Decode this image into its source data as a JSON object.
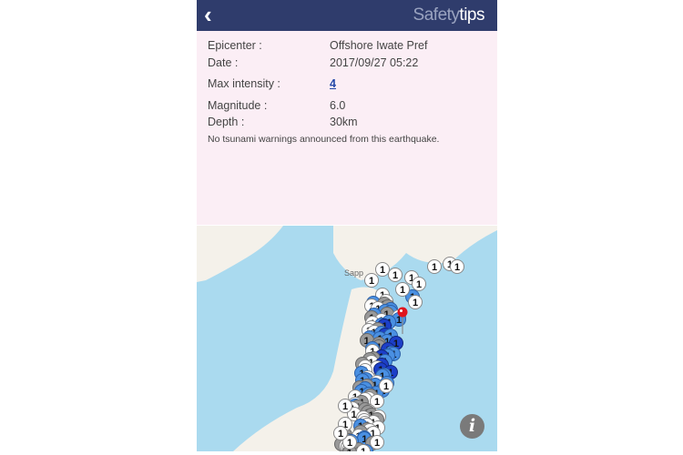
{
  "header": {
    "back_icon": "chevron-left-icon",
    "title_light": "Safety",
    "title_bold": "tips"
  },
  "details": {
    "epicenter_label": "Epicenter :",
    "epicenter": "Offshore Iwate Pref",
    "date_label": "Date :",
    "date": "2017/09/27 05:22",
    "intensity_label": "Max intensity :",
    "intensity": "4",
    "magnitude_label": "Magnitude :",
    "magnitude": "6.0",
    "depth_label": "Depth :",
    "depth": "30km",
    "tsunami_note": "No tsunami warnings announced from this earthquake."
  },
  "map": {
    "city_label": "Sapp",
    "marker_label": "1",
    "info_icon": "info-icon",
    "epicenter_pin_color": "#e0141e",
    "water_color": "#aadaef",
    "land_color": "#f4f1ea"
  }
}
